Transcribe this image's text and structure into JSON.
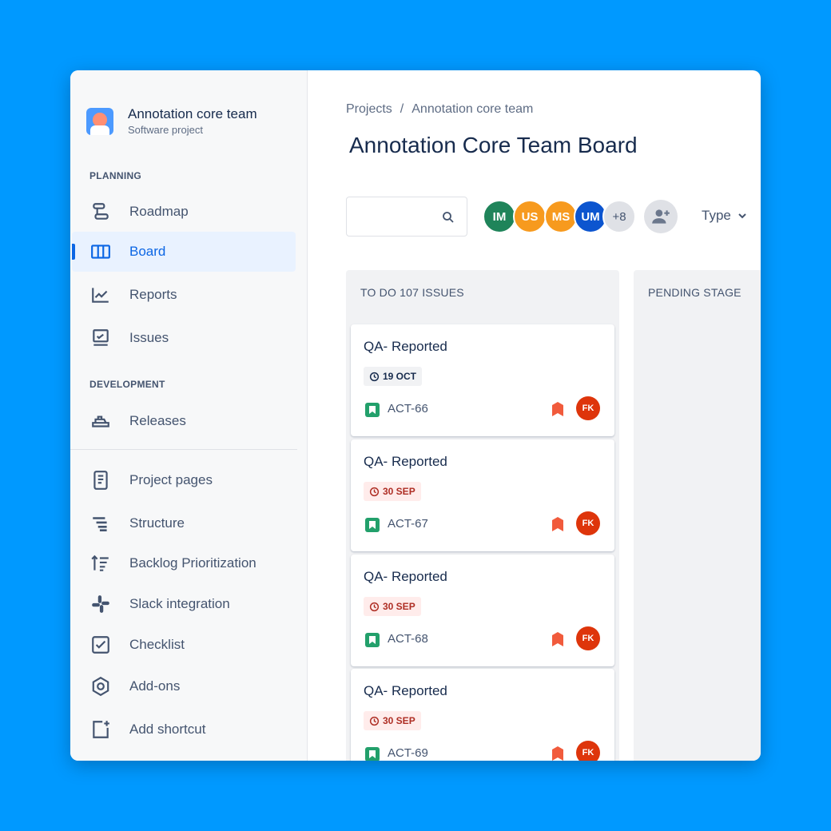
{
  "project": {
    "name": "Annotation core team",
    "type": "Software project"
  },
  "sidebar": {
    "planning_label": "PLANNING",
    "planning_items": [
      {
        "label": "Roadmap",
        "icon": "roadmap-icon"
      },
      {
        "label": "Board",
        "icon": "board-icon",
        "active": true
      },
      {
        "label": "Reports",
        "icon": "reports-icon"
      },
      {
        "label": "Issues",
        "icon": "issues-icon"
      }
    ],
    "development_label": "DEVELOPMENT",
    "development_items": [
      {
        "label": "Releases",
        "icon": "releases-icon"
      }
    ],
    "other_items": [
      {
        "label": "Project pages",
        "icon": "page-icon"
      },
      {
        "label": "Structure",
        "icon": "structure-icon"
      },
      {
        "label": "Backlog Prioritization",
        "icon": "sort-icon"
      },
      {
        "label": "Slack integration",
        "icon": "slack-icon"
      },
      {
        "label": "Checklist",
        "icon": "checklist-icon"
      },
      {
        "label": "Add-ons",
        "icon": "addons-icon"
      },
      {
        "label": "Add shortcut",
        "icon": "add-shortcut-icon"
      }
    ]
  },
  "breadcrumb": {
    "root": "Projects",
    "separator": "/",
    "current": "Annotation core team"
  },
  "page_title": "Annotation Core Team Board",
  "search": {
    "placeholder": ""
  },
  "avatars": [
    {
      "initials": "IM",
      "color": "#1f845a"
    },
    {
      "initials": "US",
      "color": "#f79a1e"
    },
    {
      "initials": "MS",
      "color": "#f79a1e"
    },
    {
      "initials": "UM",
      "color": "#0c55cf"
    },
    {
      "initials": "+8",
      "color": "#dfe1e6"
    }
  ],
  "type_filter": "Type",
  "columns": [
    {
      "title": "TO DO 107 ISSUES"
    },
    {
      "title": "PENDING STAGE"
    }
  ],
  "cards": [
    {
      "title": "QA- Reported",
      "due": "19 OCT",
      "overdue": false,
      "key": "ACT-66",
      "assignee": "FK"
    },
    {
      "title": "QA- Reported",
      "due": "30 SEP",
      "overdue": true,
      "key": "ACT-67",
      "assignee": "FK"
    },
    {
      "title": "QA- Reported",
      "due": "30 SEP",
      "overdue": true,
      "key": "ACT-68",
      "assignee": "FK"
    },
    {
      "title": "QA- Reported",
      "due": "30 SEP",
      "overdue": true,
      "key": "ACT-69",
      "assignee": "FK"
    }
  ],
  "colors": {
    "background": "#0099ff",
    "active_nav": "#0c66e4",
    "story": "#22a06b",
    "priority": "#f15b3c",
    "assignee": "#de350b"
  }
}
